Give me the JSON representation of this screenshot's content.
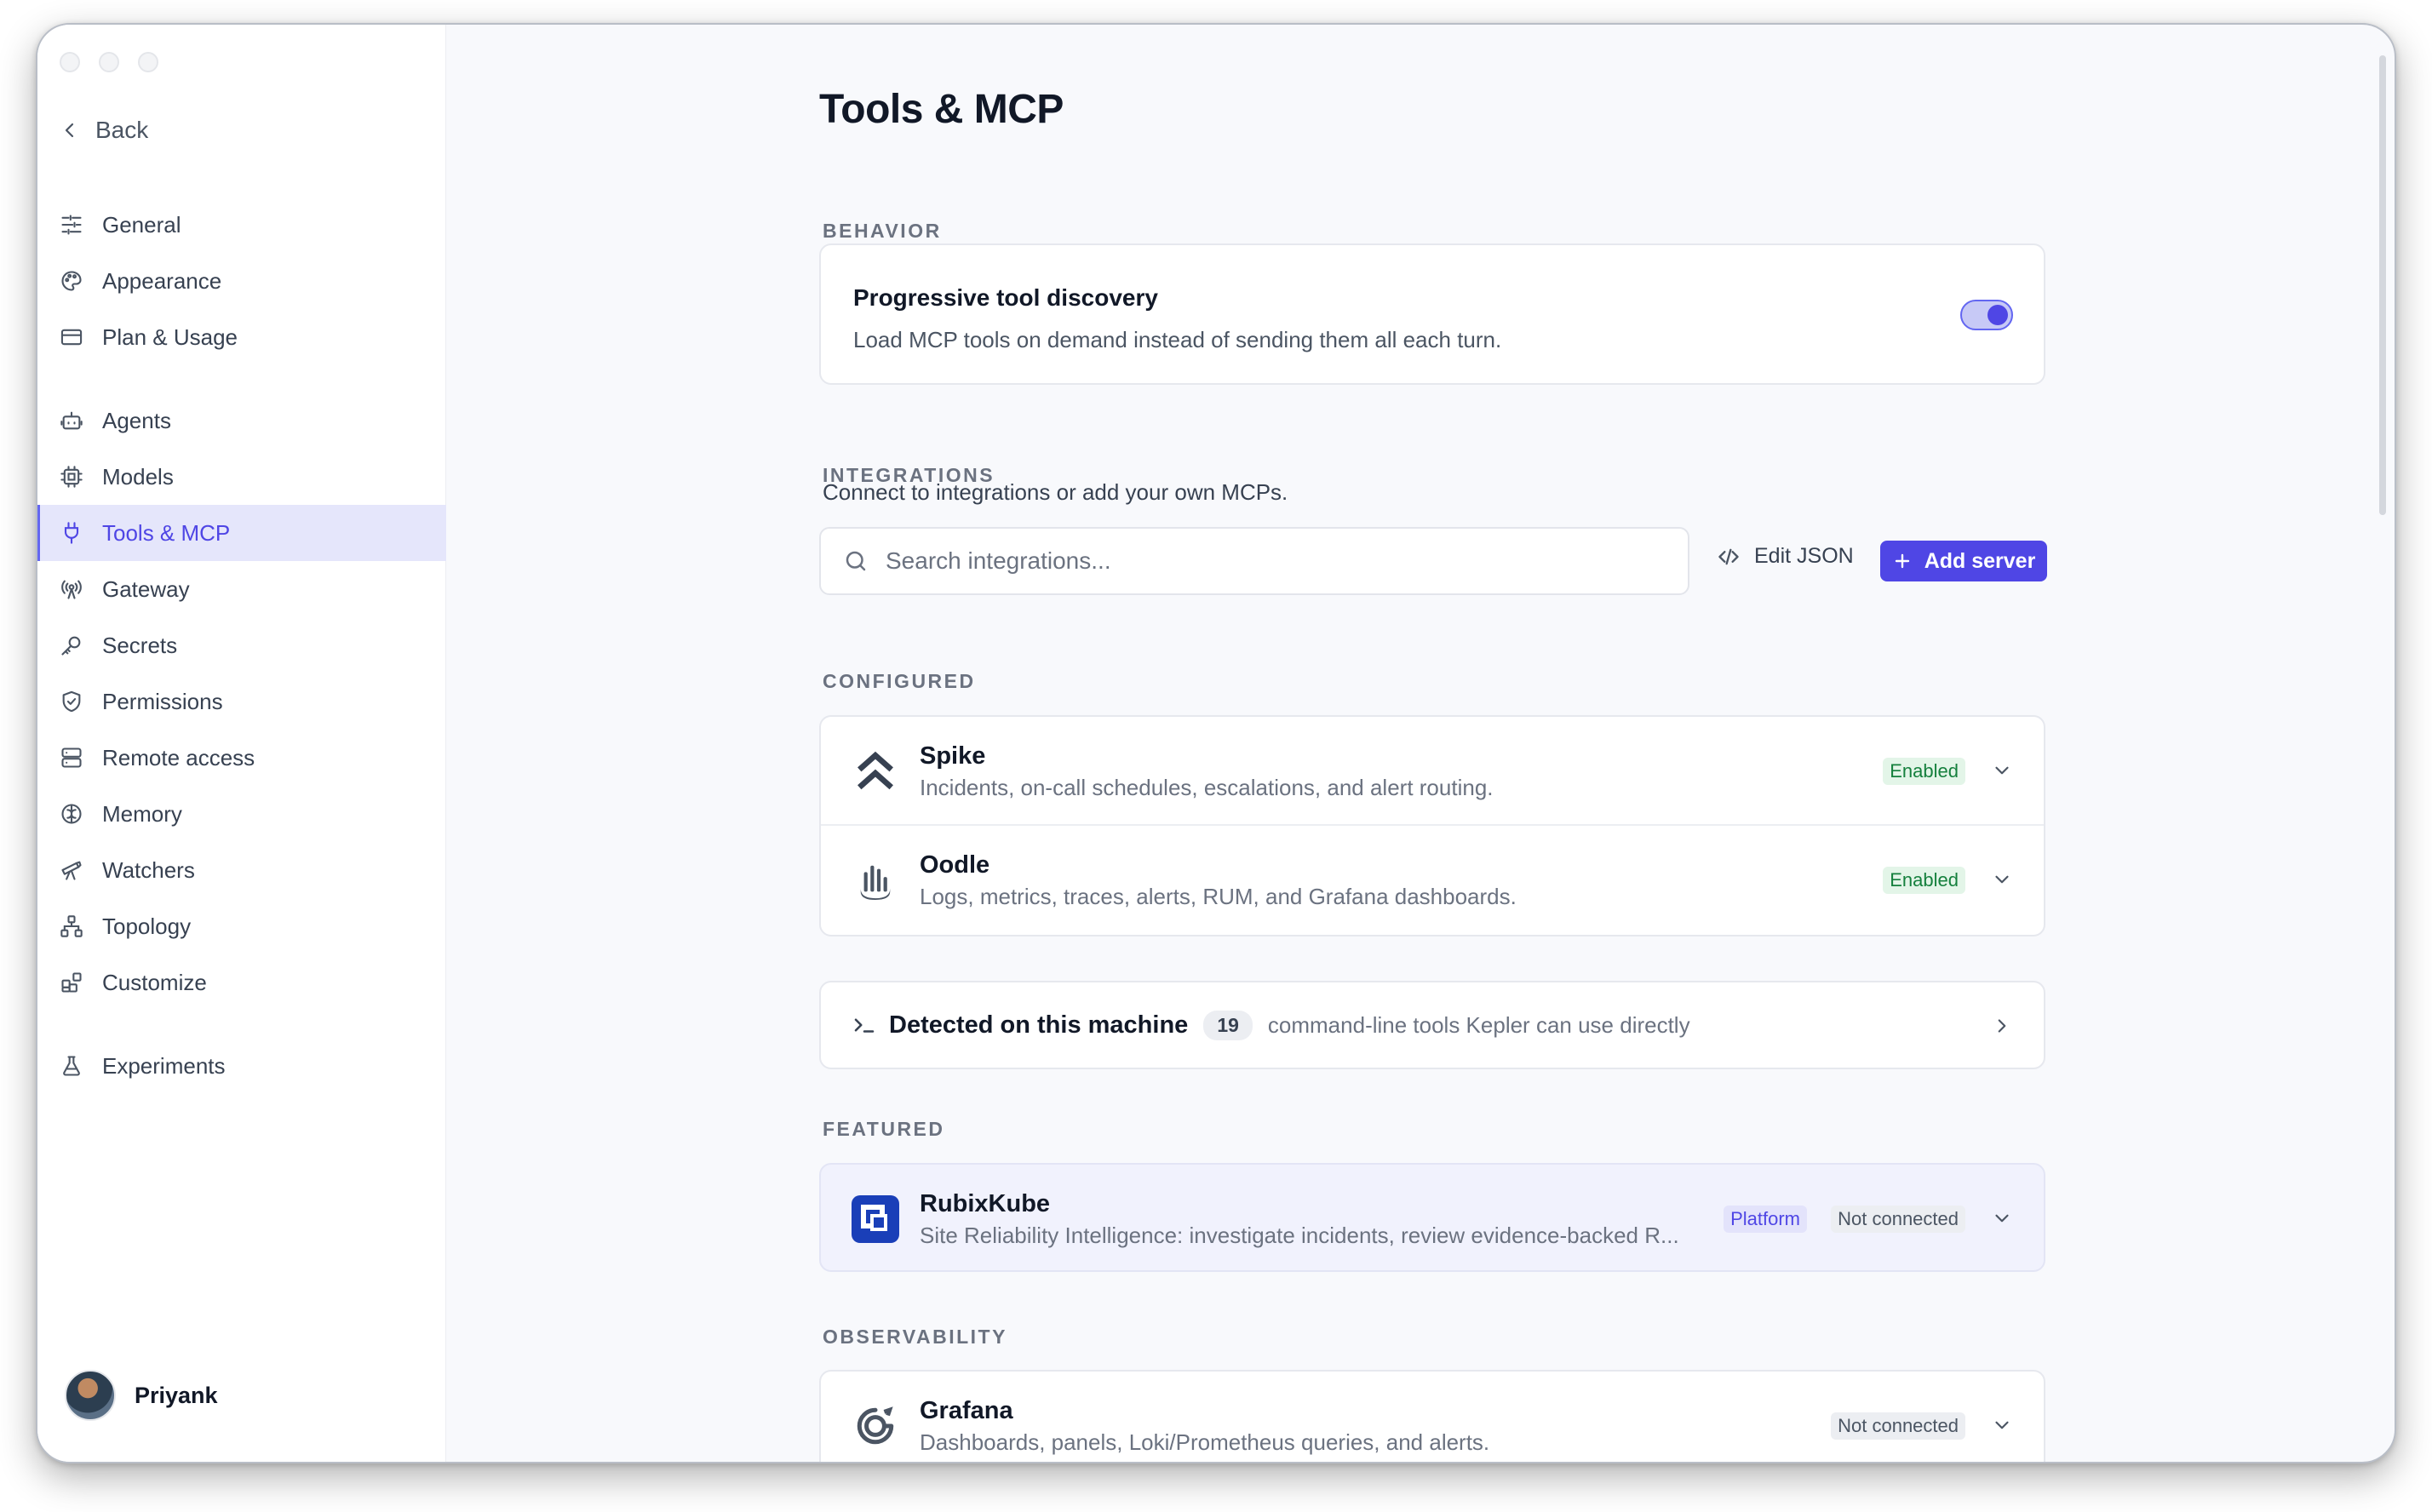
{
  "sidebar": {
    "back_label": "Back",
    "items": [
      {
        "label": "General",
        "icon": "sliders-icon"
      },
      {
        "label": "Appearance",
        "icon": "palette-icon"
      },
      {
        "label": "Plan & Usage",
        "icon": "credit-card-icon"
      },
      {
        "label": "Agents",
        "icon": "bot-icon"
      },
      {
        "label": "Models",
        "icon": "cpu-icon"
      },
      {
        "label": "Tools & MCP",
        "icon": "plug-icon",
        "active": true
      },
      {
        "label": "Gateway",
        "icon": "radio-tower-icon"
      },
      {
        "label": "Secrets",
        "icon": "key-icon"
      },
      {
        "label": "Permissions",
        "icon": "shield-check-icon"
      },
      {
        "label": "Remote access",
        "icon": "server-icon"
      },
      {
        "label": "Memory",
        "icon": "brain-icon"
      },
      {
        "label": "Watchers",
        "icon": "telescope-icon"
      },
      {
        "label": "Topology",
        "icon": "network-icon"
      },
      {
        "label": "Customize",
        "icon": "blocks-icon"
      },
      {
        "label": "Experiments",
        "icon": "flask-icon"
      }
    ],
    "user": {
      "name": "Priyank"
    }
  },
  "main": {
    "title": "Tools & MCP",
    "behavior": {
      "section_label": "BEHAVIOR",
      "title": "Progressive tool discovery",
      "description": "Load MCP tools on demand instead of sending them all each turn.",
      "toggle_on": true
    },
    "integrations": {
      "section_label": "INTEGRATIONS",
      "description": "Connect to integrations or add your own MCPs.",
      "search_placeholder": "Search integrations...",
      "edit_json_label": "Edit JSON",
      "add_server_label": "Add server"
    },
    "configured": {
      "section_label": "CONFIGURED",
      "items": [
        {
          "name": "Spike",
          "description": "Incidents, on-call schedules, escalations, and alert routing.",
          "status": "Enabled"
        },
        {
          "name": "Oodle",
          "description": "Logs, metrics, traces, alerts, RUM, and Grafana dashboards.",
          "status": "Enabled"
        }
      ]
    },
    "detected": {
      "title": "Detected on this machine",
      "count": "19",
      "description": "command-line tools Kepler can use directly"
    },
    "featured": {
      "section_label": "FEATURED",
      "items": [
        {
          "name": "RubixKube",
          "description": "Site Reliability Intelligence: investigate incidents, review evidence-backed R...",
          "tag": "Platform",
          "status": "Not connected"
        }
      ]
    },
    "observability": {
      "section_label": "OBSERVABILITY",
      "items": [
        {
          "name": "Grafana",
          "description": "Dashboards, panels, Loki/Prometheus queries, and alerts.",
          "status": "Not connected"
        }
      ]
    }
  },
  "colors": {
    "accent": "#4f46e5",
    "active_bg": "#e5e6fb",
    "enabled_bg": "#e3f5e8",
    "enabled_text": "#15803d",
    "rubixkube_brand": "#1a3fb8"
  }
}
